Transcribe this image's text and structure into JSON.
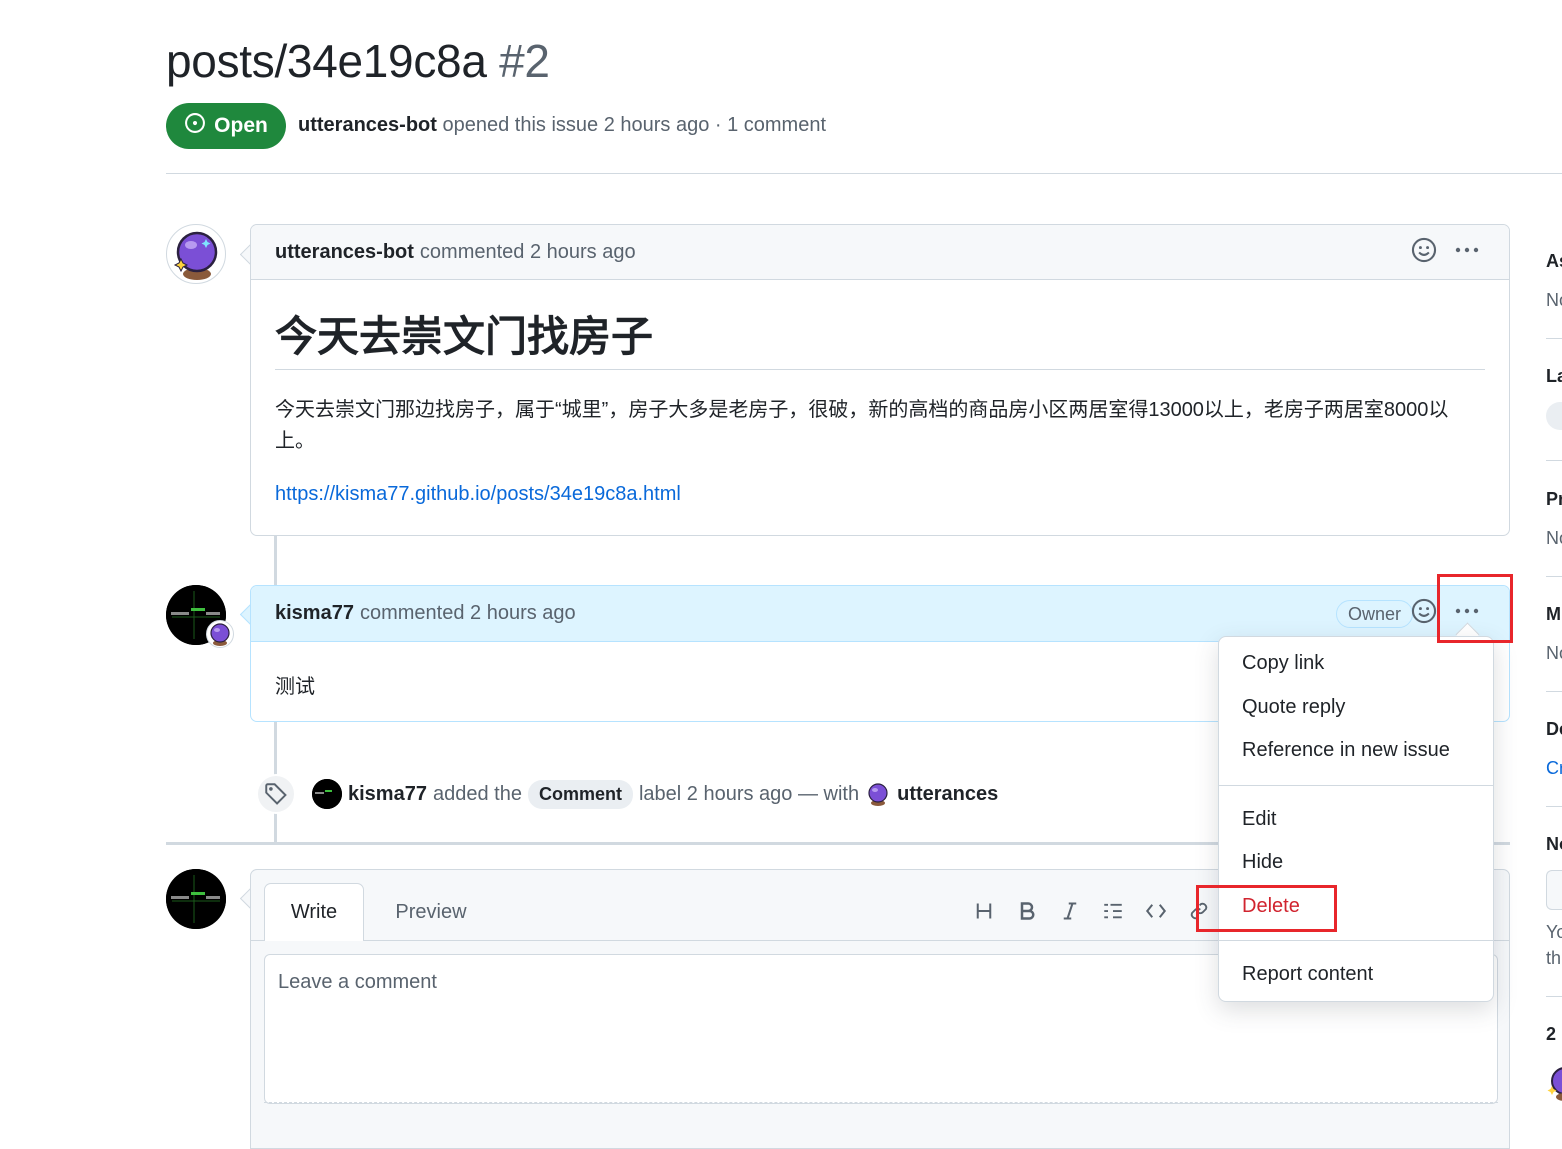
{
  "issue": {
    "title": "posts/34e19c8a",
    "number": "#2",
    "state": "Open",
    "author": "utterances-bot",
    "meta_text": "opened this issue 2 hours ago · 1 comment"
  },
  "comments": [
    {
      "author": "utterances-bot",
      "action": "commented 2 hours ago",
      "heading": "今天去崇文门找房子",
      "body": "今天去崇文门那边找房子，属于“城里”，房子大多是老房子，很破，新的高档的商品房小区两居室得13000以上，老房子两居室8000以上。",
      "link": "https://kisma77.github.io/posts/34e19c8a.html"
    },
    {
      "author": "kisma77",
      "action": "commented 2 hours ago",
      "badge": "Owner",
      "body": "测试"
    }
  ],
  "event": {
    "actor": "kisma77",
    "text_before": "added the",
    "label": "Comment",
    "text_after": "label 2 hours ago — with",
    "app": "utterances"
  },
  "editor": {
    "tab_write": "Write",
    "tab_preview": "Preview",
    "placeholder": "Leave a comment",
    "toolbar": [
      "heading-icon",
      "bold-icon",
      "italic-icon",
      "list-icon",
      "code-icon",
      "link-icon"
    ]
  },
  "menu": {
    "group1": [
      "Copy link",
      "Quote reply",
      "Reference in new issue"
    ],
    "group2": [
      "Edit",
      "Hide",
      "Delete"
    ],
    "group3": [
      "Report content"
    ]
  },
  "sidebar": {
    "assignees_head": "As",
    "assignees_val": "No",
    "labels_head": "La",
    "projects_head": "Pr",
    "projects_val": "No",
    "milestone_head": "M",
    "milestone_val": "No",
    "dev_head": "De",
    "dev_val": "Cr",
    "notif_head": "No",
    "notif_text1": "Yo",
    "notif_text2": "th",
    "participants_head": "2"
  },
  "colors": {
    "open_green": "#1f883d",
    "link_blue": "#0969da",
    "danger_red": "#d1242f",
    "highlight_red": "#e8262b",
    "owner_comment_bg": "#ddf4ff"
  }
}
